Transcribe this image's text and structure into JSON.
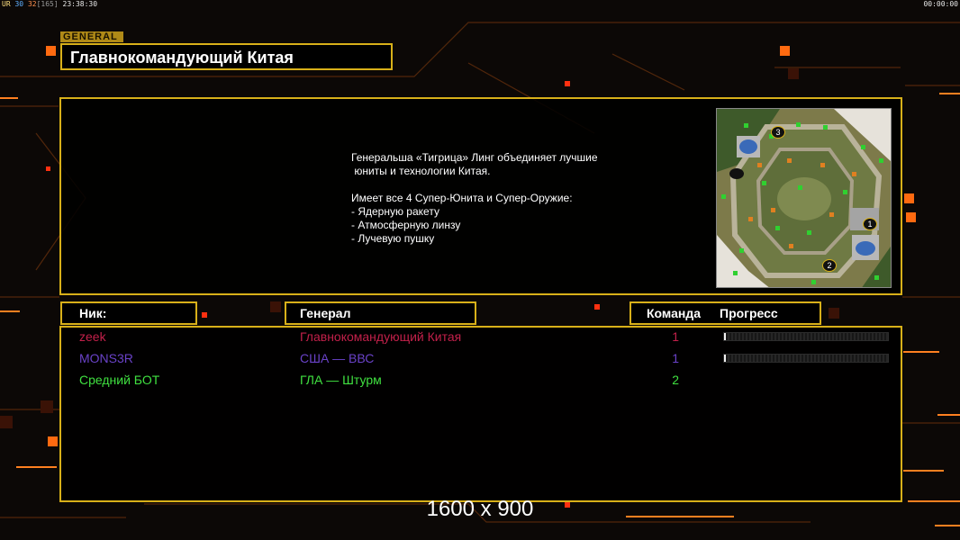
{
  "hud": {
    "ur_label": "UR",
    "fps_a": "30",
    "fps_b": "32",
    "ping": "[165]",
    "clock": "23:38:30",
    "timer": "00:00:00"
  },
  "general": {
    "tag": "GENERAL",
    "name": "Главнокомандующий Китая",
    "description": "Генеральша «Тигрица» Линг объединяет лучшие\n юниты и технологии Китая.\n\nИмеет все 4 Супер-Юнита и Супер-Оружие:\n- Ядерную ракету\n- Атмосферную линзу\n- Лучевую пушку"
  },
  "map": {
    "start_positions": [
      "1",
      "2",
      "3"
    ]
  },
  "headers": {
    "nick": "Ник:",
    "general": "Генерал",
    "team": "Команда",
    "progress": "Прогресс"
  },
  "players": [
    {
      "nick": "zeek",
      "general": "Главнокомандующий Китая",
      "team": "1",
      "color": "#c2204a",
      "progress": 0.01,
      "show_progress": true
    },
    {
      "nick": "MONS3R",
      "general": "США — ВВС",
      "team": "1",
      "color": "#6a42c8",
      "progress": 0.0,
      "show_progress": true
    },
    {
      "nick": "Средний БОТ",
      "general": "ГЛА — Штурм",
      "team": "2",
      "color": "#40e040",
      "progress": null,
      "show_progress": false
    }
  ],
  "resolution": "1600 x 900",
  "colors": {
    "accent_gold": "#d8b019",
    "hud_orange": "#ff6a10"
  }
}
